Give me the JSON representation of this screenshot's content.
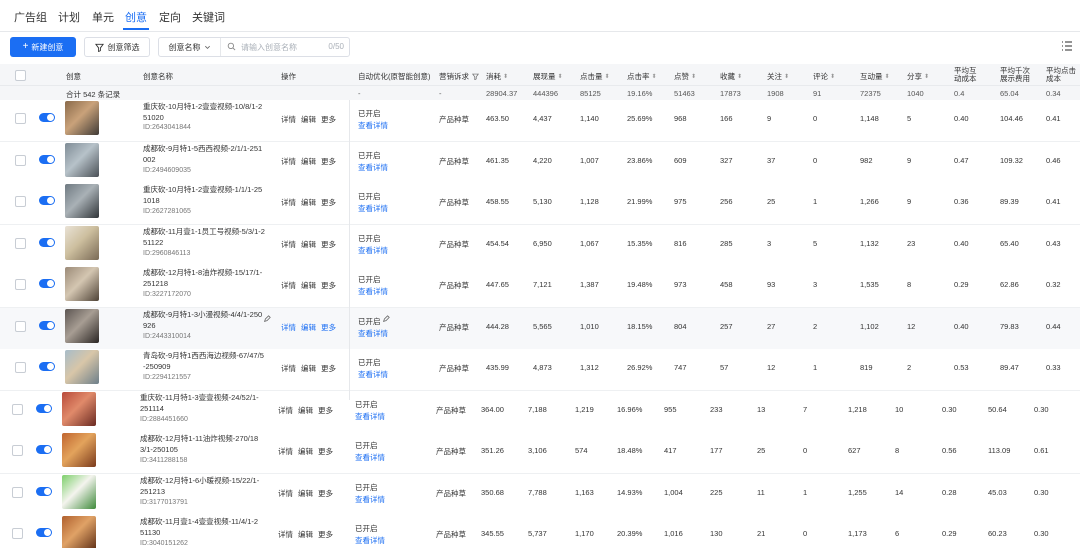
{
  "tabs": [
    "广告组",
    "计划",
    "单元",
    "创意",
    "定向",
    "关键词"
  ],
  "active_tab": 3,
  "toolbar": {
    "new_label": "新建创意",
    "filter_label": "创意筛选",
    "select_label": "创意名称",
    "search_placeholder": "请输入创意名称",
    "search_count": "0/50"
  },
  "headers": {
    "creative": "创意",
    "name": "创意名称",
    "actions": "操作",
    "auto": "自动优化(原智能创意)",
    "marketing": "营销诉求",
    "spend": "消耗",
    "impressions": "展现量",
    "clicks": "点击量",
    "ctr": "点击率",
    "likes": "点赞",
    "favorites": "收藏",
    "follows": "关注",
    "comments": "评论",
    "interactions": "互动量",
    "shares": "分享",
    "avg_interaction_cost": "平均互动成本",
    "avg_cpm": "平均千次展示费用",
    "avg_click_cost": "平均点击成本"
  },
  "summary": {
    "total": "合计 542 条记录",
    "auto": "-",
    "marketing": "-",
    "spend": "28904.37",
    "impressions": "444396",
    "clicks": "85125",
    "ctr": "19.16%",
    "likes": "51463",
    "favorites": "17873",
    "follows": "1908",
    "comments": "91",
    "interactions": "72375",
    "shares": "1040",
    "avg_interaction_cost": "0.4",
    "avg_cpm": "65.04",
    "avg_click_cost": "0.34"
  },
  "actions": {
    "detail": "详情",
    "edit": "编辑",
    "more": "更多"
  },
  "status": {
    "on": "已开启",
    "view": "查看详情"
  },
  "rows": [
    {
      "name": "重庆砍-10月特1-2壹壹视频-10/8/1-251020",
      "id": "ID:2643041844",
      "marketing": "产品种草",
      "spend": "463.50",
      "impressions": "4,437",
      "clicks": "1,140",
      "ctr": "25.69%",
      "likes": "968",
      "favorites": "166",
      "follows": "9",
      "comments": "0",
      "interactions": "1,148",
      "shares": "5",
      "aic": "0.40",
      "cpm": "104.46",
      "acc": "0.41",
      "thumb": [
        "#8a6a4a",
        "#c9a27a",
        "#3f3a36"
      ]
    },
    {
      "name": "成都砍-9月特1-5西西视频-2/1/1-251002",
      "id": "ID:2494609035",
      "marketing": "产品种草",
      "spend": "461.35",
      "impressions": "4,220",
      "clicks": "1,007",
      "ctr": "23.86%",
      "likes": "609",
      "favorites": "327",
      "follows": "37",
      "comments": "0",
      "interactions": "982",
      "shares": "9",
      "aic": "0.47",
      "cpm": "109.32",
      "acc": "0.46",
      "thumb": [
        "#7f8c96",
        "#b7c2c9",
        "#4a5056"
      ]
    },
    {
      "name": "重庆砍-10月特1-2壹壹视频-1/1/1-251018",
      "id": "ID:2627281065",
      "marketing": "产品种草",
      "spend": "458.55",
      "impressions": "5,130",
      "clicks": "1,128",
      "ctr": "21.99%",
      "likes": "975",
      "favorites": "256",
      "follows": "25",
      "comments": "1",
      "interactions": "1,266",
      "shares": "9",
      "aic": "0.36",
      "cpm": "89.39",
      "acc": "0.41",
      "thumb": [
        "#6f7a82",
        "#a9b1b6",
        "#2f3438"
      ]
    },
    {
      "name": "成都砍-11月壹1-1员工号视频-5/3/1-251122",
      "id": "ID:2960846113",
      "marketing": "产品种草",
      "spend": "454.54",
      "impressions": "6,950",
      "clicks": "1,067",
      "ctr": "15.35%",
      "likes": "816",
      "favorites": "285",
      "follows": "3",
      "comments": "5",
      "interactions": "1,132",
      "shares": "23",
      "aic": "0.40",
      "cpm": "65.40",
      "acc": "0.43",
      "thumb": [
        "#e9e2d6",
        "#cdbf9f",
        "#7a6a55"
      ]
    },
    {
      "name": "成都砍-12月特1-8油炸视频-15/17/1-251218",
      "id": "ID:3227172070",
      "marketing": "产品种草",
      "spend": "447.65",
      "impressions": "7,121",
      "clicks": "1,387",
      "ctr": "19.48%",
      "likes": "973",
      "favorites": "458",
      "follows": "93",
      "comments": "3",
      "interactions": "1,535",
      "shares": "8",
      "aic": "0.29",
      "cpm": "62.86",
      "acc": "0.32",
      "thumb": [
        "#9b8a78",
        "#d4c6b1",
        "#4e4236"
      ]
    },
    {
      "name": "成都砍-9月特1-3小漫视频-4/4/1-250926",
      "id": "ID:2443310014",
      "marketing": "产品种草",
      "spend": "444.28",
      "impressions": "5,565",
      "clicks": "1,010",
      "ctr": "18.15%",
      "likes": "804",
      "favorites": "257",
      "follows": "27",
      "comments": "2",
      "interactions": "1,102",
      "shares": "12",
      "aic": "0.40",
      "cpm": "79.83",
      "acc": "0.44",
      "thumb": [
        "#5c5552",
        "#a79d93",
        "#2a2523"
      ]
    },
    {
      "name": "青岛砍-9月特1西西海边视频-67/47/5-250909",
      "id": "ID:2294121557",
      "marketing": "产品种草",
      "spend": "435.99",
      "impressions": "4,873",
      "clicks": "1,312",
      "ctr": "26.92%",
      "likes": "747",
      "favorites": "57",
      "follows": "12",
      "comments": "1",
      "interactions": "819",
      "shares": "2",
      "aic": "0.53",
      "cpm": "89.47",
      "acc": "0.33",
      "thumb": [
        "#a7bcc9",
        "#d8c6a8",
        "#6d7f8a"
      ]
    },
    {
      "name": "重庆砍-11月特1-3壹壹视频-24/52/1-251114",
      "id": "ID:2884451660",
      "marketing": "产品种草",
      "spend": "364.00",
      "impressions": "7,188",
      "clicks": "1,219",
      "ctr": "16.96%",
      "likes": "955",
      "favorites": "233",
      "follows": "13",
      "comments": "7",
      "interactions": "1,218",
      "shares": "10",
      "aic": "0.30",
      "cpm": "50.64",
      "acc": "0.30",
      "thumb": [
        "#b84a3a",
        "#e08a6a",
        "#6a2a22"
      ]
    },
    {
      "name": "成都砍-12月特1-11油炸视频-270/183/1-250105",
      "id": "ID:3411288158",
      "marketing": "产品种草",
      "spend": "351.26",
      "impressions": "3,106",
      "clicks": "574",
      "ctr": "18.48%",
      "likes": "417",
      "favorites": "177",
      "follows": "25",
      "comments": "0",
      "interactions": "627",
      "shares": "8",
      "aic": "0.56",
      "cpm": "113.09",
      "acc": "0.61",
      "thumb": [
        "#c0652f",
        "#e3a35c",
        "#7a3a1c"
      ]
    },
    {
      "name": "成都砍-12月特1-6小暖视频-15/22/1-251213",
      "id": "ID:3177013791",
      "marketing": "产品种草",
      "spend": "350.68",
      "impressions": "7,788",
      "clicks": "1,163",
      "ctr": "14.93%",
      "likes": "1,004",
      "favorites": "225",
      "follows": "11",
      "comments": "1",
      "interactions": "1,255",
      "shares": "14",
      "aic": "0.28",
      "cpm": "45.03",
      "acc": "0.30",
      "thumb": [
        "#7ccf6a",
        "#f4f4ee",
        "#3e8a3a"
      ]
    },
    {
      "name": "成都砍-11月壹1-4壹壹视频-11/4/1-251130",
      "id": "ID:3040151262",
      "marketing": "产品种草",
      "spend": "345.55",
      "impressions": "5,737",
      "clicks": "1,170",
      "ctr": "20.39%",
      "likes": "1,016",
      "favorites": "130",
      "follows": "21",
      "comments": "0",
      "interactions": "1,173",
      "shares": "6",
      "aic": "0.29",
      "cpm": "60.23",
      "acc": "0.30",
      "thumb": [
        "#b0602e",
        "#e0a266",
        "#5e2e16"
      ]
    }
  ]
}
